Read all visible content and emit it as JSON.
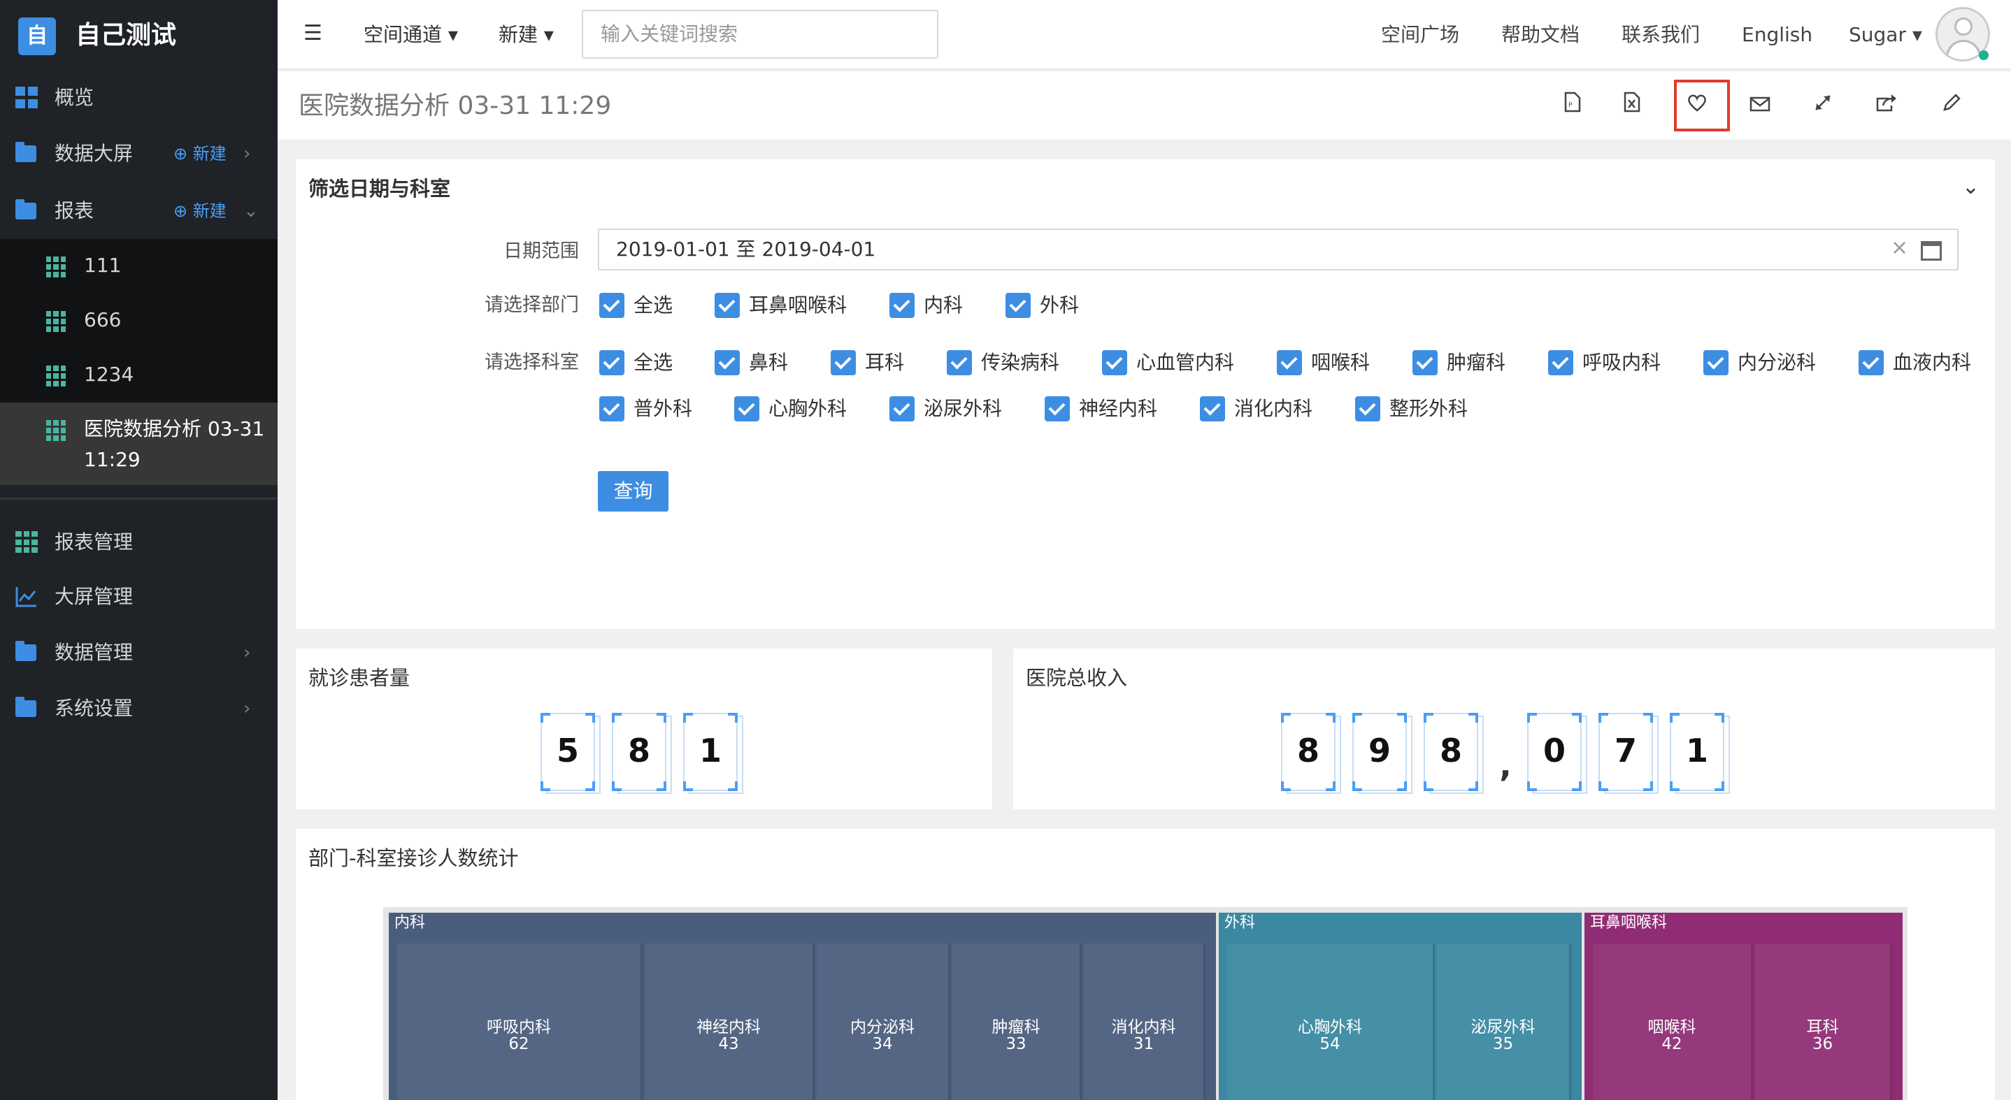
{
  "app": {
    "logo_char": "自",
    "title": "自己测试"
  },
  "sidebar": {
    "overview": "概览",
    "bigscreen": "数据大屏",
    "bigscreen_new": "新建",
    "reports": "报表",
    "reports_new": "新建",
    "report_items": [
      "111",
      "666",
      "1234",
      "医院数据分析 03-31 11:29"
    ],
    "report_mgmt": "报表管理",
    "screen_mgmt": "大屏管理",
    "data_mgmt": "数据管理",
    "sys_settings": "系统设置"
  },
  "topbar": {
    "space_channel": "空间通道",
    "new": "新建",
    "search_placeholder": "输入关键词搜索",
    "space_square": "空间广场",
    "help_docs": "帮助文档",
    "contact": "联系我们",
    "english": "English",
    "user": "Sugar"
  },
  "page": {
    "title": "医院数据分析 03-31 11:29"
  },
  "filter": {
    "title": "筛选日期与科室",
    "date_label": "日期范围",
    "date_value": "2019-01-01 至 2019-04-01",
    "dept_label": "请选择部门",
    "depts": [
      "全选",
      "耳鼻咽喉科",
      "内科",
      "外科"
    ],
    "office_label": "请选择科室",
    "offices_row1": [
      "全选",
      "鼻科",
      "耳科",
      "传染病科",
      "心血管内科",
      "咽喉科",
      "肿瘤科",
      "呼吸内科",
      "内分泌科",
      "血液内科"
    ],
    "offices_row2": [
      "普外科",
      "心胸外科",
      "泌尿外科",
      "神经内科",
      "消化内科",
      "整形外科"
    ],
    "query_btn": "查询"
  },
  "kpi": {
    "patients_title": "就诊患者量",
    "patients_digits": [
      "5",
      "8",
      "1"
    ],
    "income_title": "医院总收入",
    "income_digits": [
      "8",
      "9",
      "8",
      ",",
      "0",
      "7",
      "1"
    ]
  },
  "chart_panel_title": "部门-科室接诊人数统计",
  "chart_data": {
    "type": "treemap",
    "title": "部门-科室接诊人数统计",
    "groups": [
      {
        "name": "内科",
        "color": "#4b5d7d",
        "children": [
          {
            "name": "呼吸内科",
            "value": 62
          },
          {
            "name": "神经内科",
            "value": 43
          },
          {
            "name": "内分泌科",
            "value": 34
          },
          {
            "name": "肿瘤科",
            "value": 33
          },
          {
            "name": "消化内科",
            "value": 31
          }
        ]
      },
      {
        "name": "外科",
        "color": "#3a88a2",
        "children": [
          {
            "name": "心胸外科",
            "value": 54
          },
          {
            "name": "泌尿外科",
            "value": 35
          }
        ]
      },
      {
        "name": "耳鼻咽喉科",
        "color": "#8f2c74",
        "children": [
          {
            "name": "咽喉科",
            "value": 42
          },
          {
            "name": "耳科",
            "value": 36
          }
        ]
      }
    ]
  },
  "colors": {
    "primary": "#3d8ee3",
    "sidebar_bg": "#1f2227",
    "highlight": "#e03b2e"
  }
}
